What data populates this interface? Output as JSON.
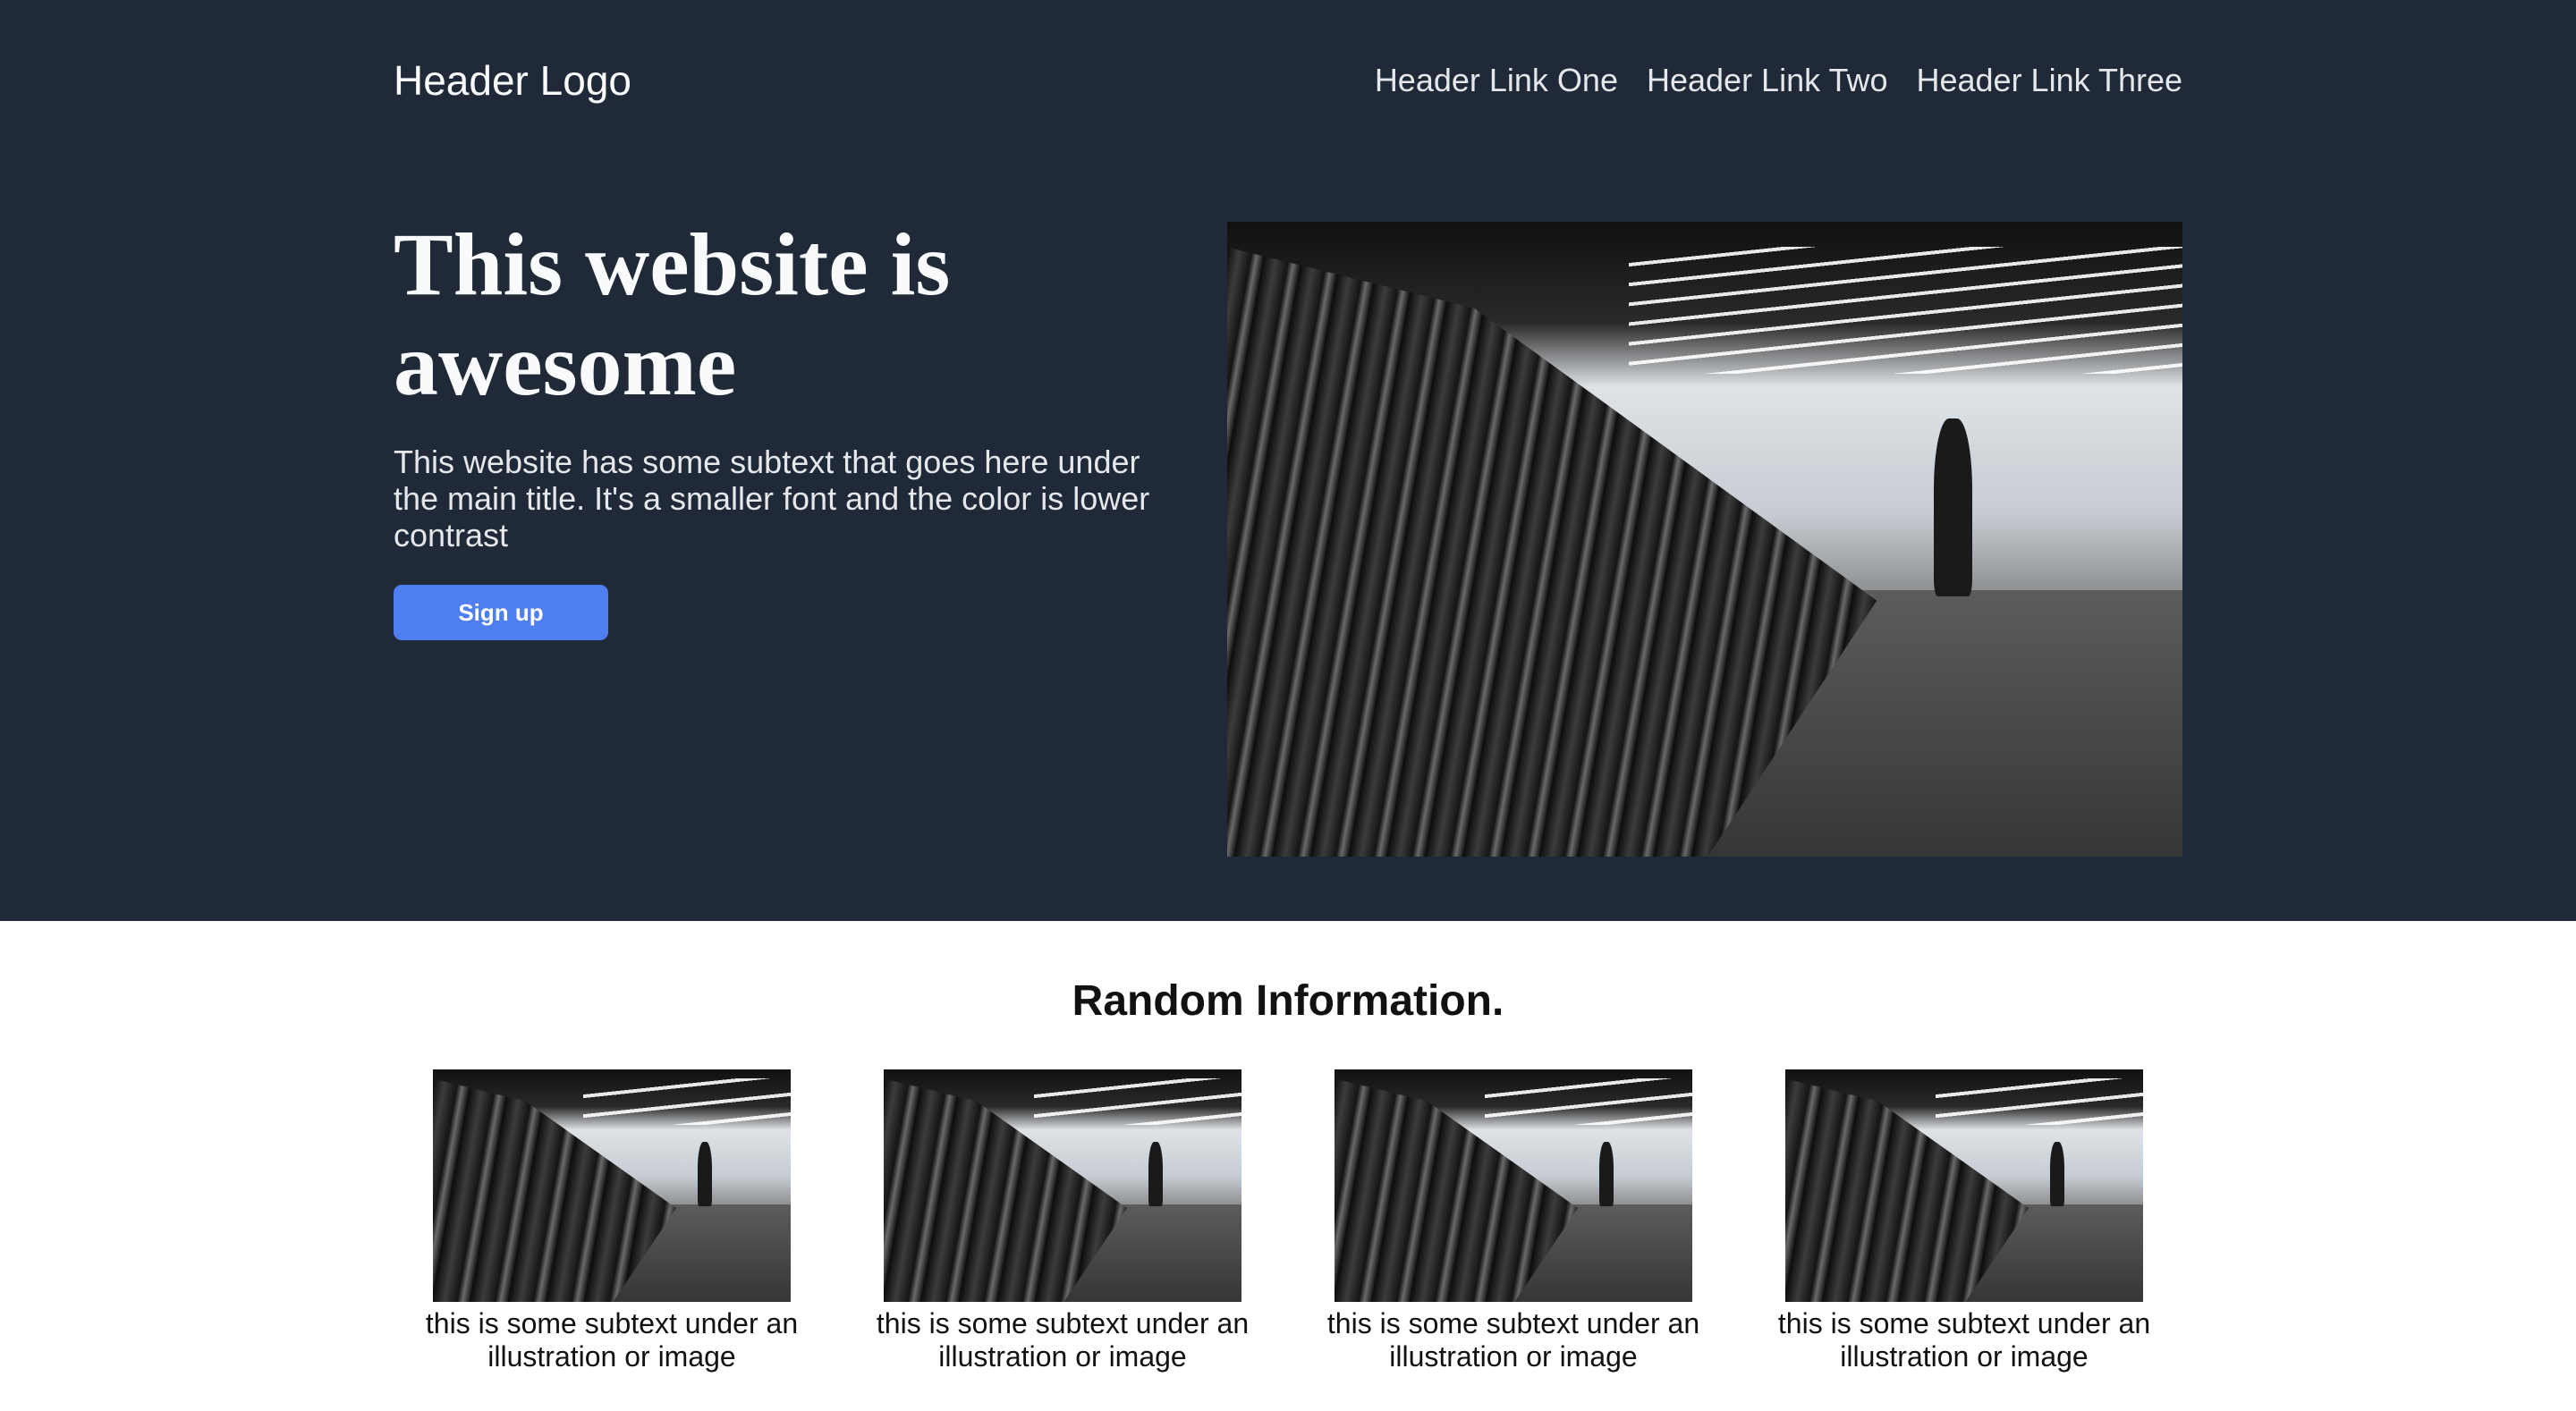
{
  "header": {
    "logo": "Header Logo",
    "links": [
      "Header Link One",
      "Header Link Two",
      "Header Link Three"
    ]
  },
  "hero": {
    "title": "This website is awesome",
    "subtext": "This website has some subtext that goes here under the main title. It's a smaller font and the color is lower contrast",
    "button_label": "Sign up",
    "image": "gym-dumbbell-rack-photo"
  },
  "info": {
    "title": "Random Information.",
    "cards": [
      {
        "caption": "this is some subtext under an illustration or image",
        "image": "gym-dumbbell-rack-photo"
      },
      {
        "caption": "this is some subtext under an illustration or image",
        "image": "gym-dumbbell-rack-photo"
      },
      {
        "caption": "this is some subtext under an illustration or image",
        "image": "gym-dumbbell-rack-photo"
      },
      {
        "caption": "this is some subtext under an illustration or image",
        "image": "gym-dumbbell-rack-photo"
      }
    ]
  },
  "colors": {
    "hero_background": "#1f2937",
    "button": "#4f7ef0"
  }
}
